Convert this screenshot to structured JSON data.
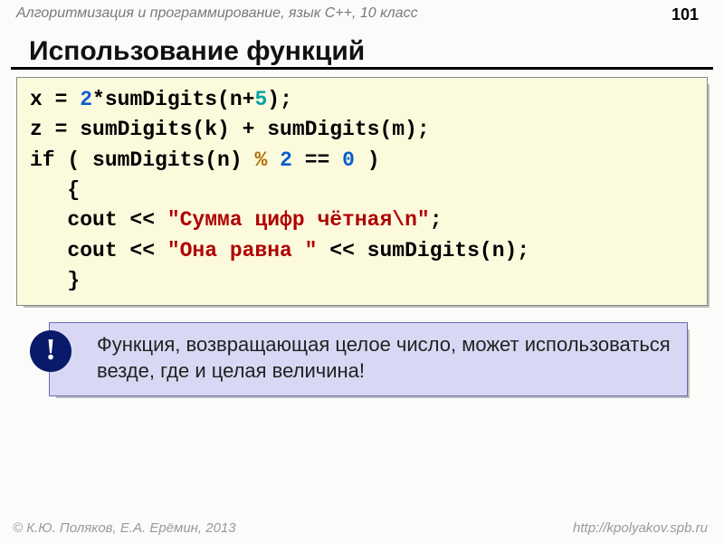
{
  "header": {
    "subject": "Алгоритмизация и программирование, язык C++, 10 класс",
    "page": "101"
  },
  "title": "Использование функций",
  "code": {
    "l1a": "x = ",
    "l1b": "2",
    "l1c": "*sumDigits(n+",
    "l1d": "5",
    "l1e": ");",
    "l2": "z = sumDigits(k) + sumDigits(m);",
    "l3a": "if ( sumDigits(n) ",
    "l3b": "%",
    "l3c": " ",
    "l3d": "2",
    "l3e": " == ",
    "l3f": "0",
    "l3g": " )",
    "l4": "   {",
    "l5a": "   cout << ",
    "l5b": "\"Сумма цифр чётная\\n\"",
    "l5c": ";",
    "l6a": "   cout << ",
    "l6b": "\"Она равна \"",
    "l6c": " << sumDigits(n);",
    "l7": "   }"
  },
  "note": {
    "bang": "!",
    "text": "Функция, возвращающая целое число, может использоваться везде, где и целая величина!"
  },
  "footer": {
    "left": "© К.Ю. Поляков, Е.А. Ерёмин, 2013",
    "right": "http://kpolyakov.spb.ru"
  }
}
